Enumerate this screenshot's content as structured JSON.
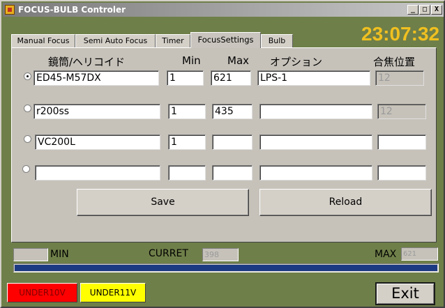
{
  "window": {
    "title": "FOCUS-BULB Controler",
    "controls": {
      "minimize": "_",
      "maximize": "□",
      "close": "X"
    }
  },
  "clock": "23:07:32",
  "tabs": [
    {
      "label": "Manual Focus",
      "active": false
    },
    {
      "label": "Semi Auto Focus",
      "active": false
    },
    {
      "label": "Timer",
      "active": false
    },
    {
      "label": "FocusSettings",
      "active": true
    },
    {
      "label": "Bulb",
      "active": false
    }
  ],
  "settings": {
    "headers": {
      "lens": "鏡筒/ヘリコイド",
      "min": "Min",
      "max": "Max",
      "option": "オプション",
      "focus_pos": "合焦位置"
    },
    "rows": [
      {
        "selected": true,
        "lens": "ED45-M57DX",
        "min": "1",
        "max": "621",
        "option": "LPS-1",
        "focus_pos": "12"
      },
      {
        "selected": false,
        "lens": "r200ss",
        "min": "1",
        "max": "435",
        "option": "",
        "focus_pos": "12"
      },
      {
        "selected": false,
        "lens": "VC200L",
        "min": "1",
        "max": "",
        "option": "",
        "focus_pos": ""
      },
      {
        "selected": false,
        "lens": "",
        "min": "",
        "max": "",
        "option": "",
        "focus_pos": ""
      }
    ],
    "save_label": "Save",
    "reload_label": "Reload"
  },
  "status": {
    "min_label": "MIN",
    "min_value": "",
    "current_label": "CURRET",
    "current_value": "398",
    "max_label": "MAX",
    "max_value": "621",
    "progress_fraction": 1.0
  },
  "buttons": {
    "under10v": "UNDER10V",
    "under11v": "UNDER11V",
    "exit": "Exit"
  },
  "colors": {
    "background": "#6f7f49",
    "clock": "#f0c020",
    "progress": "#1c3a82",
    "under10v_bg": "#ff0000",
    "under11v_bg": "#ffff00"
  }
}
